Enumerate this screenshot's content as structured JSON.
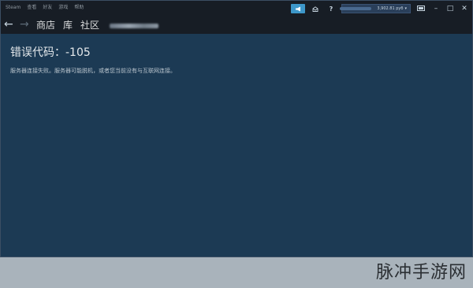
{
  "menu": {
    "items": [
      "Steam",
      "查看",
      "好友",
      "游戏",
      "帮助"
    ]
  },
  "topbar": {
    "announce_icon": "megaphone-icon",
    "mail_icon": "envelope-icon",
    "help_label": "?",
    "balance": "3,902.81 руб",
    "caret": "▾",
    "minimize_label": "–",
    "restore_label": "□",
    "close_label": "✕"
  },
  "nav": {
    "back_label": "←",
    "forward_label": "→",
    "links": [
      "商店",
      "库",
      "社区"
    ]
  },
  "content": {
    "error_title": "错误代码：-105",
    "error_desc": "服务器连接失败。服务器可能脱机，或者您当前没有与互联网连接。"
  },
  "watermark": "脉冲手游网",
  "colors": {
    "accent": "#3d97c9",
    "content_bg": "#1c3a54",
    "menubar_bg": "#171d25"
  }
}
